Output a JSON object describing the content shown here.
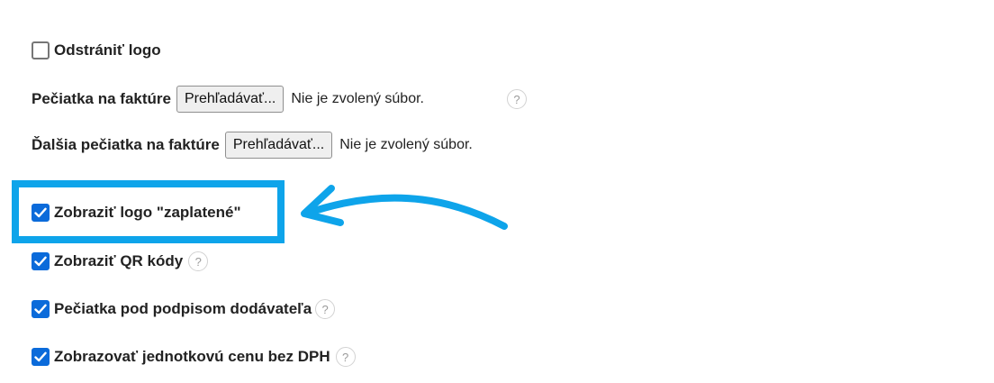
{
  "remove_logo": {
    "label": "Odstrániť logo",
    "checked": false
  },
  "invoice_stamp": {
    "label": "Pečiatka na faktúre",
    "button_label": "Prehľadávať...",
    "status": "Nie je zvolený súbor.",
    "help": "?"
  },
  "extra_invoice_stamp": {
    "label": "Ďalšia pečiatka na faktúre",
    "button_label": "Prehľadávať...",
    "status": "Nie je zvolený súbor."
  },
  "show_paid_logo": {
    "label": "Zobraziť logo \"zaplatené\"",
    "checked": true
  },
  "show_qr_codes": {
    "label": "Zobraziť QR kódy",
    "checked": true,
    "help": "?"
  },
  "stamp_under_signature": {
    "label": "Pečiatka pod podpisom dodávateľa",
    "checked": true,
    "help": "?"
  },
  "show_unit_price_without_vat": {
    "label": "Zobrazovať jednotkovú cenu bez DPH",
    "checked": true,
    "help": "?"
  },
  "colors": {
    "checkbox_accent": "#0b6bda",
    "highlight": "#0ea4ea"
  },
  "annotation_icons": {
    "arrow": "arrow-left-icon",
    "highlight": "highlight-box"
  }
}
